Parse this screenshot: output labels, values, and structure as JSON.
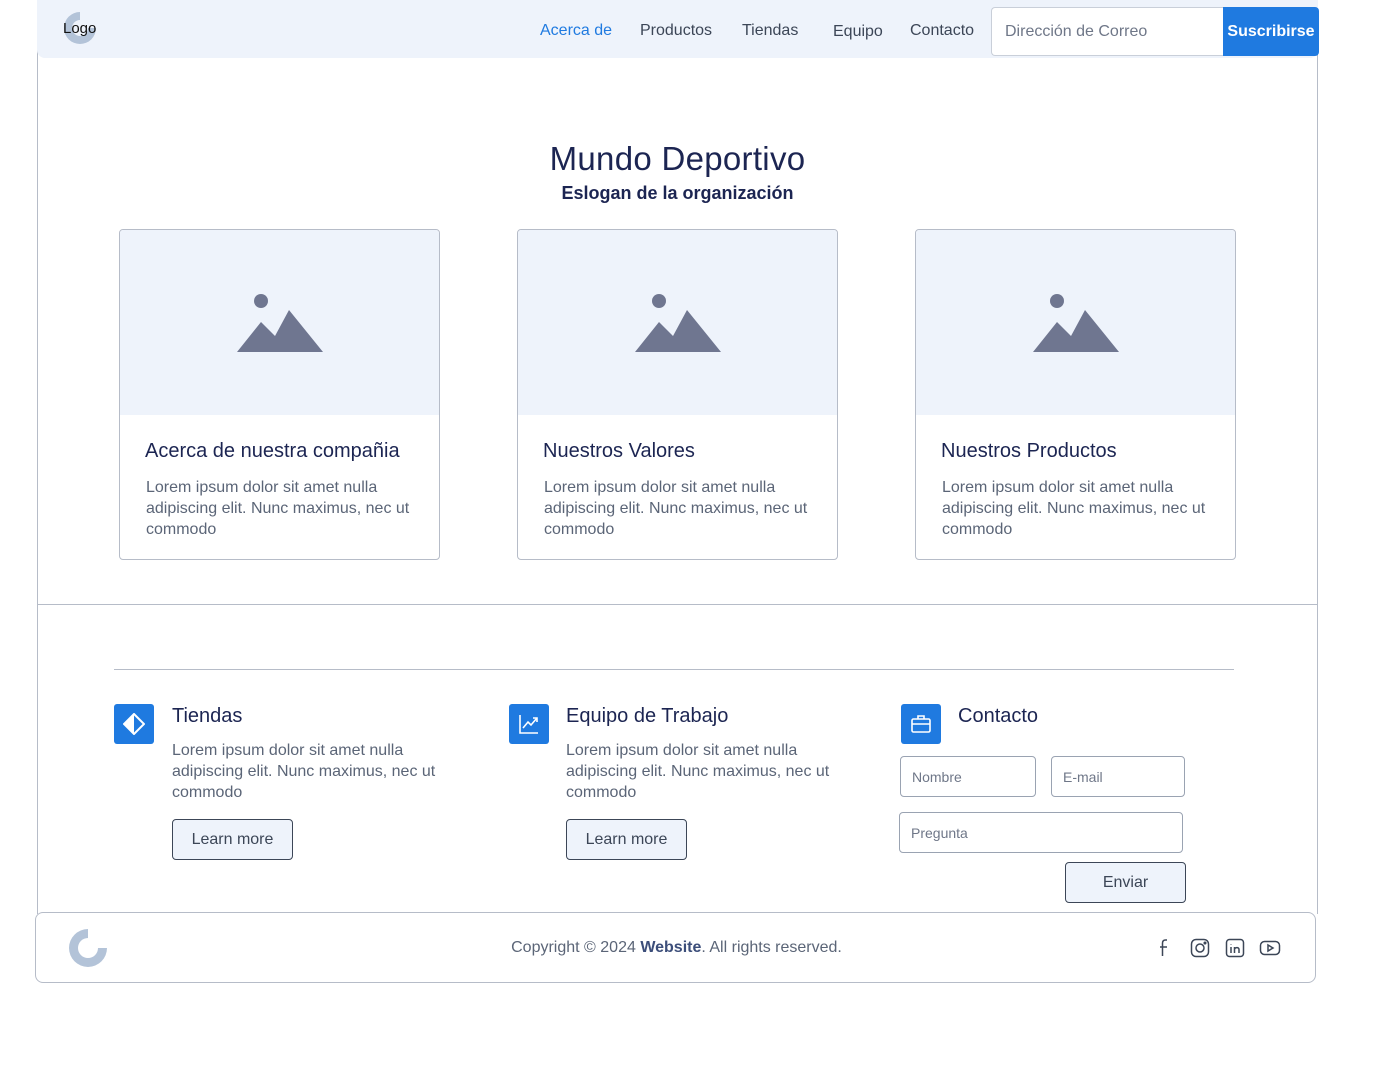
{
  "header": {
    "logo_text": "Logo",
    "nav": [
      "Acerca de",
      "Productos",
      "Tiendas",
      "Equipo",
      "Contacto"
    ],
    "active_nav": "Acerca de",
    "email_placeholder": "Dirección de Correo",
    "subscribe_label": "Suscribirse"
  },
  "hero": {
    "title": "Mundo Deportivo",
    "subtitle": "Eslogan de la organización"
  },
  "cards": [
    {
      "title": "Acerca de nuestra compañia",
      "text": "Lorem ipsum dolor sit amet nulla adipiscing elit. Nunc maximus, nec ut commodo",
      "icon": "image-placeholder-icon"
    },
    {
      "title": "Nuestros Valores",
      "text": "Lorem ipsum dolor sit amet nulla adipiscing elit. Nunc maximus, nec ut commodo",
      "icon": "image-placeholder-icon"
    },
    {
      "title": "Nuestros Productos",
      "text": "Lorem ipsum dolor sit amet nulla adipiscing elit. Nunc maximus, nec ut commodo",
      "icon": "image-placeholder-icon"
    }
  ],
  "features": [
    {
      "title": "Tiendas",
      "text": "Lorem ipsum dolor sit amet nulla adipiscing elit. Nunc maximus, nec ut commodo",
      "button": "Learn more",
      "icon": "half-diamond-icon"
    },
    {
      "title": "Equipo de Trabajo",
      "text": "Lorem ipsum dolor sit amet nulla adipiscing elit. Nunc maximus, nec ut commodo",
      "button": "Learn more",
      "icon": "trend-chart-icon"
    },
    {
      "title": "Contacto",
      "icon": "briefcase-icon"
    }
  ],
  "contact_form": {
    "name_placeholder": "Nombre",
    "email_placeholder": "E-mail",
    "question_placeholder": "Pregunta",
    "send_label": "Enviar"
  },
  "footer": {
    "copyright_prefix": "Copyright © 2024 ",
    "brand": "Website",
    "copyright_suffix": ". All rights reserved.",
    "social_icons": [
      "facebook-icon",
      "instagram-icon",
      "linkedin-icon",
      "youtube-icon"
    ]
  },
  "colors": {
    "accent": "#1f7ae0",
    "header_bg": "#eef3fb",
    "title_text": "#1c2552",
    "body_text": "#5b6577",
    "border": "#b6bcc8"
  }
}
